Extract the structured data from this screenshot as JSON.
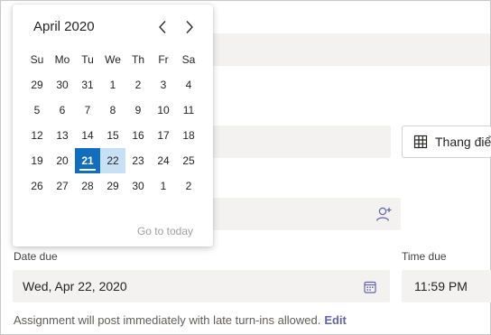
{
  "calendar": {
    "month_label": "April 2020",
    "weekdays": [
      "Su",
      "Mo",
      "Tu",
      "We",
      "Th",
      "Fr",
      "Sa"
    ],
    "weeks": [
      [
        "29",
        "30",
        "31",
        "1",
        "2",
        "3",
        "4"
      ],
      [
        "5",
        "6",
        "7",
        "8",
        "9",
        "10",
        "11"
      ],
      [
        "12",
        "13",
        "14",
        "15",
        "16",
        "17",
        "18"
      ],
      [
        "19",
        "20",
        "21",
        "22",
        "23",
        "24",
        "25"
      ],
      [
        "26",
        "27",
        "28",
        "29",
        "30",
        "1",
        "2"
      ]
    ],
    "selected_day": "21",
    "hovered_day": "22",
    "goto_today": "Go to today",
    "prev_icon": "chevron-left-icon",
    "next_icon": "chevron-right-icon"
  },
  "location": {
    "button_label": "Thang điể"
  },
  "date_due": {
    "label": "Date due",
    "value": "Wed, Apr 22, 2020",
    "icon": "calendar-icon"
  },
  "time_due": {
    "label": "Time due",
    "value": "11:59 PM"
  },
  "note": {
    "text": "Assignment will post immediately with late turn-ins allowed.",
    "edit_link": "Edit"
  },
  "colors": {
    "accent": "#106ebe",
    "hover": "#c7e0f4",
    "link": "#6264a7"
  }
}
